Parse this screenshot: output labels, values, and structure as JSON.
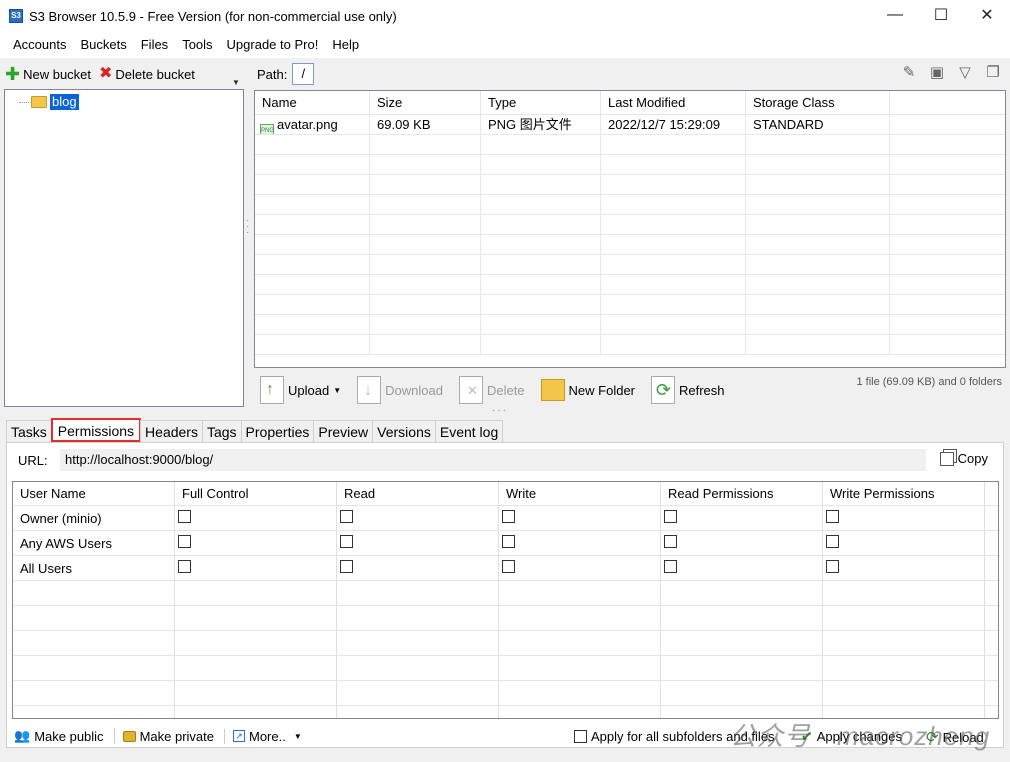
{
  "window": {
    "app_icon": "S3",
    "title": "S3 Browser 10.5.9 - Free Version (for non-commercial use only)",
    "minimize_glyph": "—",
    "maximize_glyph": "☐",
    "close_glyph": "✕"
  },
  "menu": [
    "Accounts",
    "Buckets",
    "Files",
    "Tools",
    "Upgrade to Pro!",
    "Help"
  ],
  "left_toolbar": {
    "new_bucket": "New bucket",
    "delete_bucket": "Delete bucket"
  },
  "tree": {
    "buckets": [
      "blog"
    ]
  },
  "path": {
    "label": "Path:",
    "value": "/"
  },
  "file_list": {
    "columns": [
      "Name",
      "Size",
      "Type",
      "Last Modified",
      "Storage Class"
    ],
    "rows": [
      [
        "avatar.png",
        "69.09 KB",
        "PNG 图片文件",
        "2022/12/7 15:29:09",
        "STANDARD"
      ]
    ],
    "icon_label": "PNG"
  },
  "actions": {
    "upload": "Upload",
    "download": "Download",
    "delete": "Delete",
    "new_folder": "New Folder",
    "refresh": "Refresh",
    "summary": "1 file (69.09 KB) and 0 folders"
  },
  "tabs": [
    "Tasks",
    "Permissions",
    "Headers",
    "Tags",
    "Properties",
    "Preview",
    "Versions",
    "Event log"
  ],
  "active_tab": "Permissions",
  "url": {
    "label": "URL:",
    "value": "http://localhost:9000/blog/",
    "copy": "Copy"
  },
  "permissions": {
    "columns": [
      "User Name",
      "Full Control",
      "Read",
      "Write",
      "Read Permissions",
      "Write Permissions"
    ],
    "rows": [
      {
        "user": "Owner (minio)",
        "checks": [
          false,
          false,
          false,
          false,
          false
        ]
      },
      {
        "user": "Any AWS Users",
        "checks": [
          false,
          false,
          false,
          false,
          false
        ]
      },
      {
        "user": "All Users",
        "checks": [
          false,
          false,
          false,
          false,
          false
        ]
      }
    ]
  },
  "bottom": {
    "make_public": "Make public",
    "make_private": "Make private",
    "more": "More..",
    "apply_all": "Apply for all subfolders and files",
    "apply_changes": "Apply changes",
    "reload": "Reload"
  },
  "watermark": "公众号 · macrozheng"
}
